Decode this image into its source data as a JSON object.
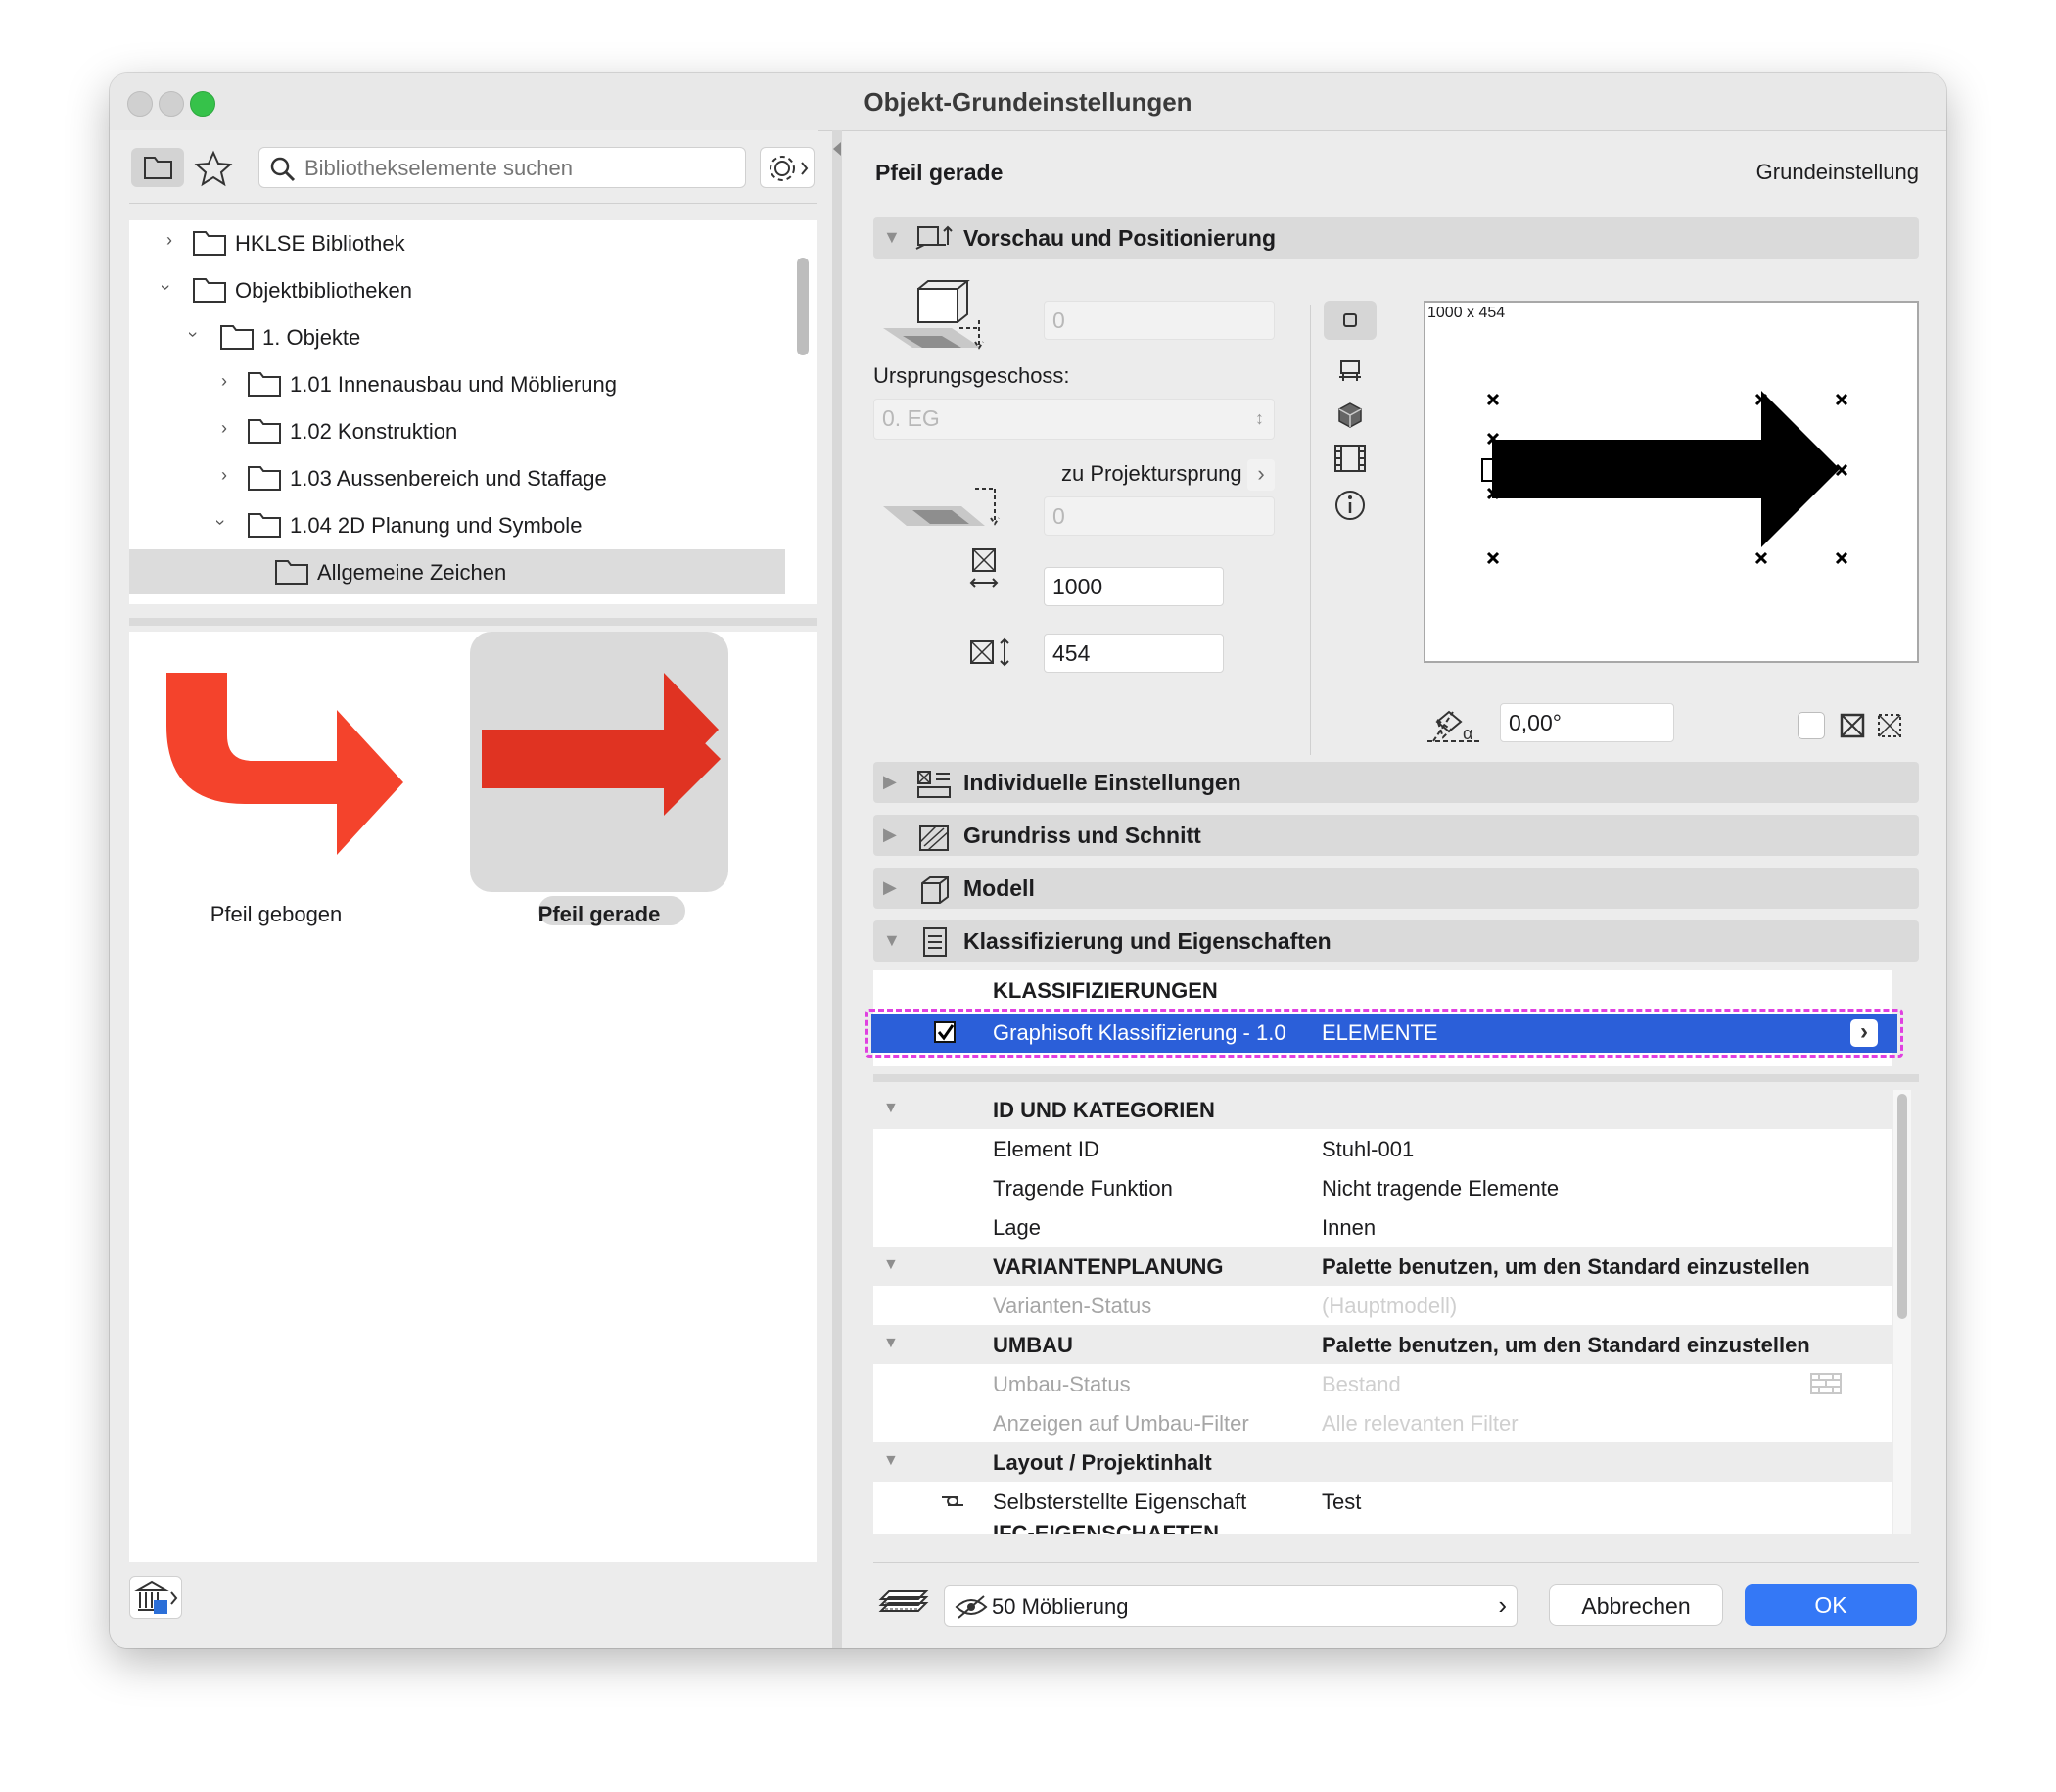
{
  "window": {
    "title": "Objekt-Grundeinstellungen"
  },
  "left": {
    "search": {
      "placeholder": "Bibliothekselemente suchen"
    },
    "tree": [
      {
        "label": "HKLSE Bibliothek",
        "level": 0,
        "expanded": false
      },
      {
        "label": "Objektbibliotheken",
        "level": 0,
        "expanded": true
      },
      {
        "label": "1. Objekte",
        "level": 1,
        "expanded": true
      },
      {
        "label": "1.01 Innenausbau und Möblierung",
        "level": 2,
        "expanded": false
      },
      {
        "label": "1.02 Konstruktion",
        "level": 2,
        "expanded": false
      },
      {
        "label": "1.03 Aussenbereich und Staffage",
        "level": 2,
        "expanded": false
      },
      {
        "label": "1.04 2D Planung und Symbole",
        "level": 2,
        "expanded": true
      },
      {
        "label": "Allgemeine Zeichen",
        "level": 3,
        "selected": true
      }
    ],
    "gallery": [
      {
        "label": "Pfeil gebogen",
        "color": "#f4432c",
        "selected": false
      },
      {
        "label": "Pfeil gerade",
        "color": "#e03322",
        "selected": true
      }
    ]
  },
  "right": {
    "object_name": "Pfeil gerade",
    "mode_label": "Grundeinstellung",
    "sections": {
      "preview": "Vorschau und Positionierung",
      "individual": "Individuelle Einstellungen",
      "floorplan": "Grundriss und Schnitt",
      "model": "Modell",
      "classification": "Klassifizierung und Eigenschaften"
    },
    "positioning": {
      "elevation_value": "0",
      "origin_story_label": "Ursprungsgeschoss:",
      "origin_story_value": "0. EG",
      "reference_label": "zu Projektursprung",
      "offset_value": "0",
      "width_value": "1000",
      "height_value": "454",
      "angle_value": "0,00°",
      "preview_size_label": "1000 x 454"
    },
    "classifications": {
      "header": "KLASSIFIZIERUNGEN",
      "system": "Graphisoft Klassifizierung - 1.0",
      "value": "ELEMENTE",
      "checked": true
    },
    "properties": [
      {
        "type": "group",
        "key": "ID UND KATEGORIEN",
        "value": ""
      },
      {
        "type": "row",
        "key": "Element ID",
        "value": "Stuhl-001"
      },
      {
        "type": "row",
        "key": "Tragende Funktion",
        "value": "Nicht tragende Elemente"
      },
      {
        "type": "row",
        "key": "Lage",
        "value": "Innen"
      },
      {
        "type": "group",
        "key": "VARIANTENPLANUNG",
        "value": "Palette benutzen, um den Standard einzustellen"
      },
      {
        "type": "row",
        "key": "Varianten-Status",
        "value": "(Hauptmodell)",
        "disabled": true
      },
      {
        "type": "group",
        "key": "UMBAU",
        "value": "Palette benutzen, um den Standard einzustellen"
      },
      {
        "type": "row",
        "key": "Umbau-Status",
        "value": "Bestand",
        "disabled": true
      },
      {
        "type": "row",
        "key": "Anzeigen auf Umbau-Filter",
        "value": "Alle relevanten Filter",
        "disabled": true
      },
      {
        "type": "group",
        "key": "Layout / Projektinhalt",
        "value": ""
      },
      {
        "type": "row",
        "key": "Selbsterstellte Eigenschaft",
        "value": "Test",
        "linked": true
      }
    ],
    "cut_off_group": "IFC-EIGENSCHAFTEN"
  },
  "footer": {
    "layer": "50 Möblierung",
    "cancel": "Abbrechen",
    "ok": "OK"
  },
  "colors": {
    "accent": "#3478f6",
    "selection_row": "#2b5fd9",
    "highlight_border": "#e040e0",
    "arrow_red": "#e03322"
  }
}
